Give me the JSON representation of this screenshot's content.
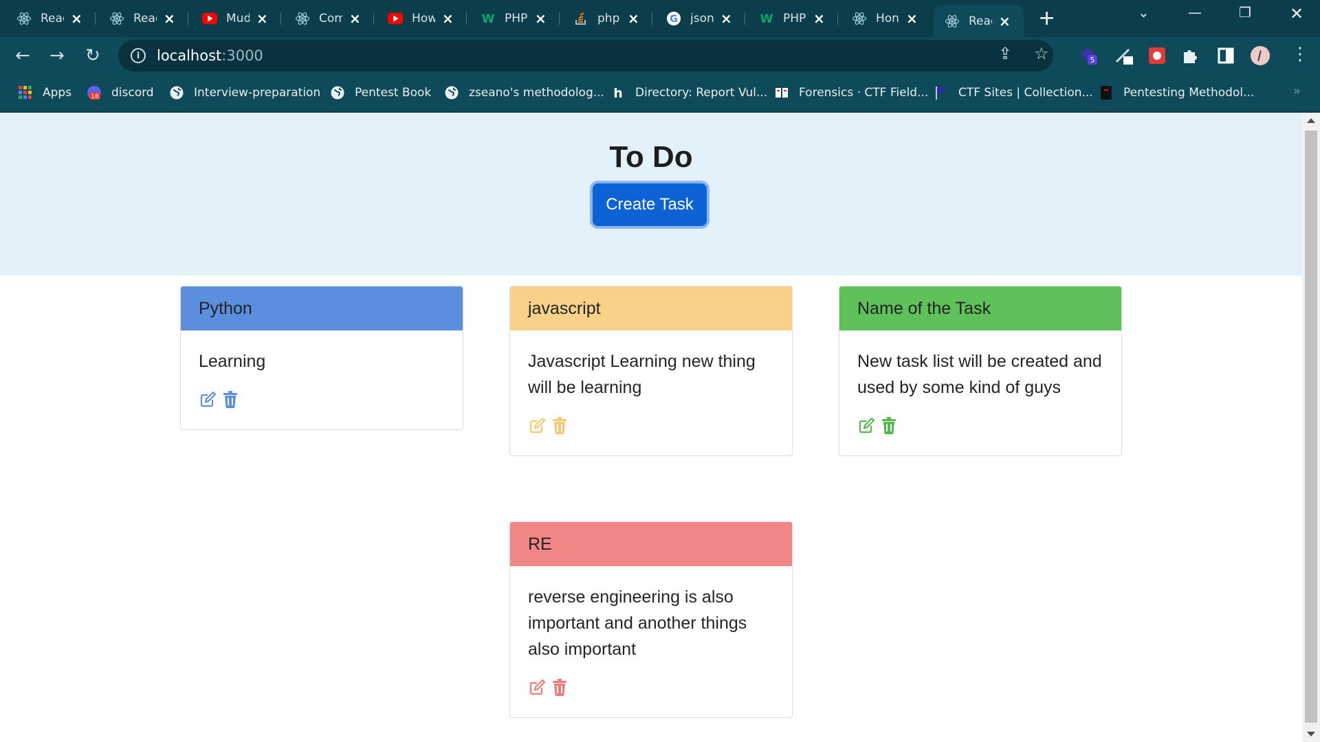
{
  "browser": {
    "tabs": [
      {
        "title": "React",
        "icon": "react-icon"
      },
      {
        "title": "React",
        "icon": "react-icon"
      },
      {
        "title": "Mud",
        "icon": "youtube-icon"
      },
      {
        "title": "Com",
        "icon": "react-icon"
      },
      {
        "title": "How",
        "icon": "youtube-icon"
      },
      {
        "title": "PHP",
        "icon": "w3schools-icon"
      },
      {
        "title": "php",
        "icon": "stackoverflow-icon"
      },
      {
        "title": "json",
        "icon": "google-icon"
      },
      {
        "title": "PHP",
        "icon": "w3schools-icon"
      },
      {
        "title": "Hon",
        "icon": "react-icon"
      },
      {
        "title": "Reac",
        "icon": "react-icon",
        "active": true
      }
    ],
    "address": {
      "host": "localhost",
      "port": ":3000"
    },
    "extension_badge": "5",
    "bookmarks": [
      {
        "label": "Apps",
        "icon": "apps-grid-icon"
      },
      {
        "label": "discord",
        "icon": "discord-icon",
        "badge": "18"
      },
      {
        "label": "Interview-preparation",
        "icon": "globe-icon"
      },
      {
        "label": "Pentest Book",
        "icon": "globe-icon"
      },
      {
        "label": "zseano's methodolog...",
        "icon": "globe-icon"
      },
      {
        "label": "Directory: Report Vul...",
        "icon": "hackerone-icon"
      },
      {
        "label": "Forensics · CTF Field...",
        "icon": "book-icon"
      },
      {
        "label": "CTF Sites | Collection...",
        "icon": "flag-icon"
      },
      {
        "label": "Pentesting Methodol...",
        "icon": "bookmark-dark-icon"
      }
    ]
  },
  "page": {
    "title": "To Do",
    "create_button": "Create Task"
  },
  "tasks": [
    {
      "name": "Python",
      "description": "Learning",
      "color": "#5b8fde",
      "accent": "#5b8fde"
    },
    {
      "name": "javascript",
      "description": "Javascript Learning new thing will be learning",
      "color": "#f9d28a",
      "accent": "#f7c96e"
    },
    {
      "name": "Name of the Task",
      "description": "New task list will be created and used by some kind of guys",
      "color": "#5ec15a",
      "accent": "#4fb84b"
    },
    {
      "name": "RE",
      "description": "reverse engineering is also important and another things also important",
      "color": "#f28585",
      "accent": "#f07a7a"
    }
  ]
}
